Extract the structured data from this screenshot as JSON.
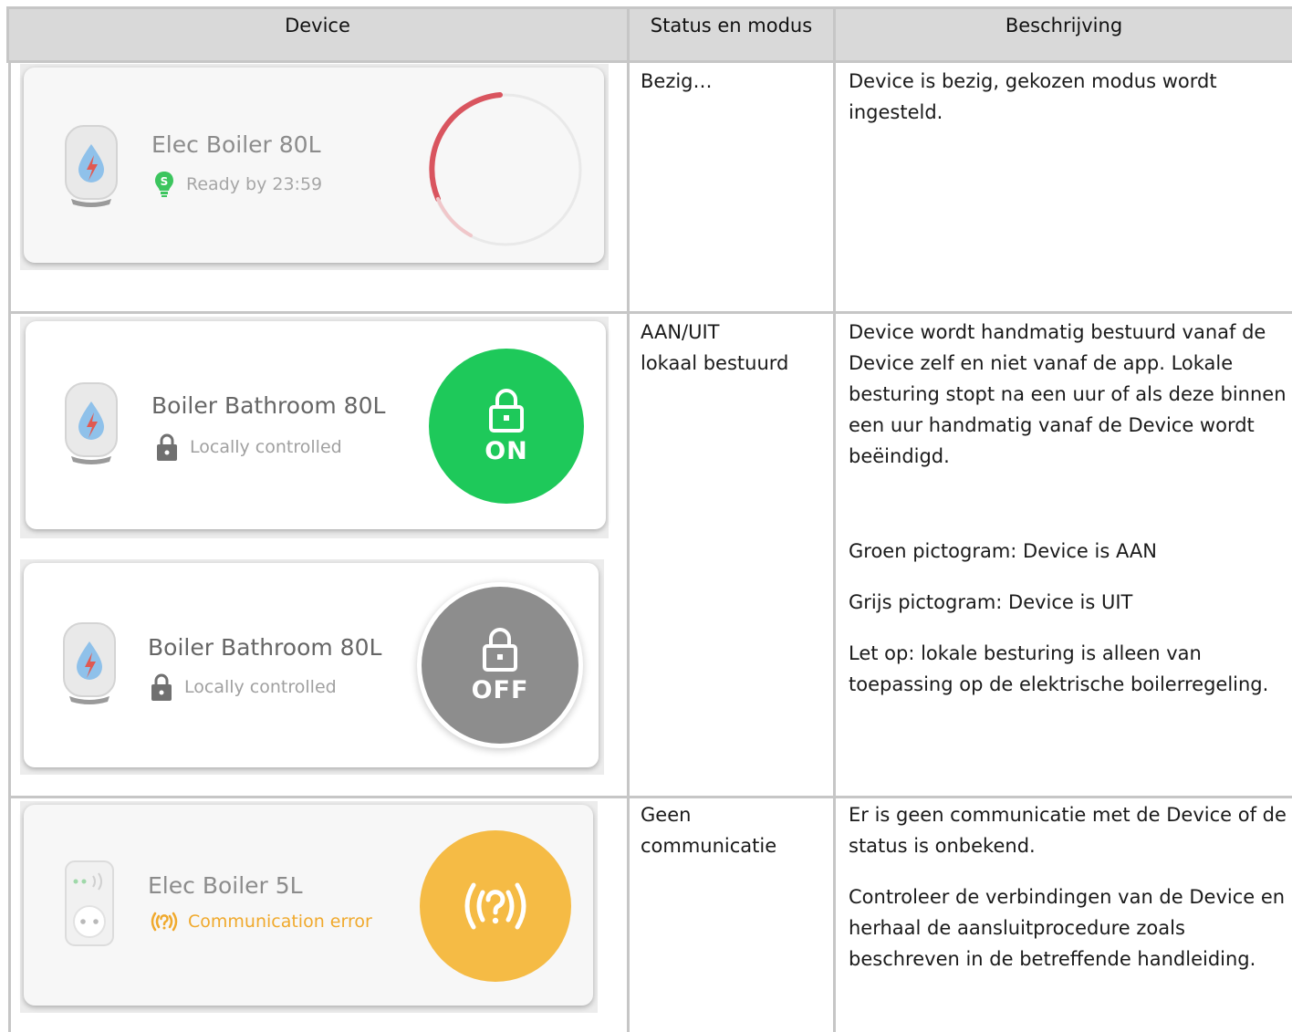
{
  "table": {
    "headers": {
      "device": "Device",
      "status": "Status en modus",
      "description": "Beschrijving"
    },
    "rows": [
      {
        "status_lines": [
          "Bezig…"
        ],
        "description_paragraphs": [
          "Device is bezig, gekozen modus wordt ingesteld."
        ],
        "cards": [
          {
            "title": "Elec Boiler 80L",
            "subtitle": "Ready by 23:59",
            "badge_letter": "S",
            "control": "loading-spinner"
          }
        ]
      },
      {
        "status_lines": [
          "AAN/UIT",
          "lokaal bestuurd"
        ],
        "description_paragraphs": [
          "Device wordt handmatig bestuurd vanaf de Device zelf en niet vanaf de app. Lokale besturing stopt na een uur of als deze binnen een uur handmatig vanaf de Device wordt beëindigd.",
          "Groen pictogram: Device is AAN",
          "Grijs pictogram: Device is UIT",
          "Let op: lokale besturing is alleen van toepassing op de elektrische boilerregeling."
        ],
        "cards": [
          {
            "title": "Boiler Bathroom 80L",
            "subtitle": "Locally controlled",
            "button_label": "ON",
            "button_color": "#1ec95a"
          },
          {
            "title": "Boiler Bathroom 80L",
            "subtitle": "Locally controlled",
            "button_label": "OFF",
            "button_color": "#8d8d8d"
          }
        ]
      },
      {
        "status_lines": [
          "Geen",
          "communicatie"
        ],
        "description_paragraphs": [
          "Er is geen communicatie met de Device of de status is onbekend.",
          "Controleer de verbindingen van de Device en herhaal de aansluitprocedure zoals beschreven in de betreffende handleiding."
        ],
        "cards": [
          {
            "title": "Elec Boiler 5L",
            "subtitle": "Communication error",
            "error_symbol": "((?))",
            "button_color": "#f5bb45"
          }
        ]
      }
    ]
  },
  "colors": {
    "spinner": "#d9555f",
    "ready_badge": "#3cc55e",
    "error_text": "#f0a92c",
    "title_dim": "#8c8c8c",
    "title_dark": "#666666",
    "subtitle": "#a0a0a0"
  },
  "icons": [
    "boiler-icon",
    "smart-bulb-icon",
    "lock-icon",
    "padlock-icon",
    "smart-plug-icon",
    "signal-question-icon"
  ]
}
